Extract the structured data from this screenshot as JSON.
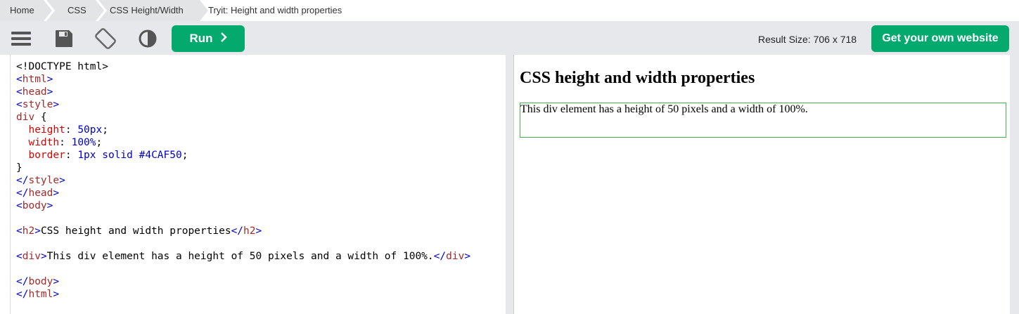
{
  "breadcrumb": {
    "items": [
      "Home",
      "CSS",
      "CSS Height/Width"
    ],
    "current": "Tryit: Height and width properties"
  },
  "toolbar": {
    "icons": [
      "menu-icon",
      "save-icon",
      "rotate-icon",
      "contrast-icon"
    ],
    "run_label": "Run",
    "result_size": "Result Size: 706 x 718",
    "get_website_label": "Get your own website"
  },
  "colors": {
    "accent": "#04aa6d",
    "border": "#4CAF50",
    "toolbar_bg": "#e6e8eb"
  },
  "editor": {
    "lines": [
      "<!DOCTYPE html>",
      "<html>",
      "<head>",
      "<style>",
      "div {",
      "  height: 50px;",
      "  width: 100%;",
      "  border: 1px solid #4CAF50;",
      "}",
      "</style>",
      "</head>",
      "<body>",
      "",
      "<h2>CSS height and width properties</h2>",
      "",
      "<div>This div element has a height of 50 pixels and a width of 100%.</div>",
      "",
      "</body>",
      "</html>"
    ]
  },
  "result": {
    "heading": "CSS height and width properties",
    "div_text": "This div element has a height of 50 pixels and a width of 100%."
  }
}
